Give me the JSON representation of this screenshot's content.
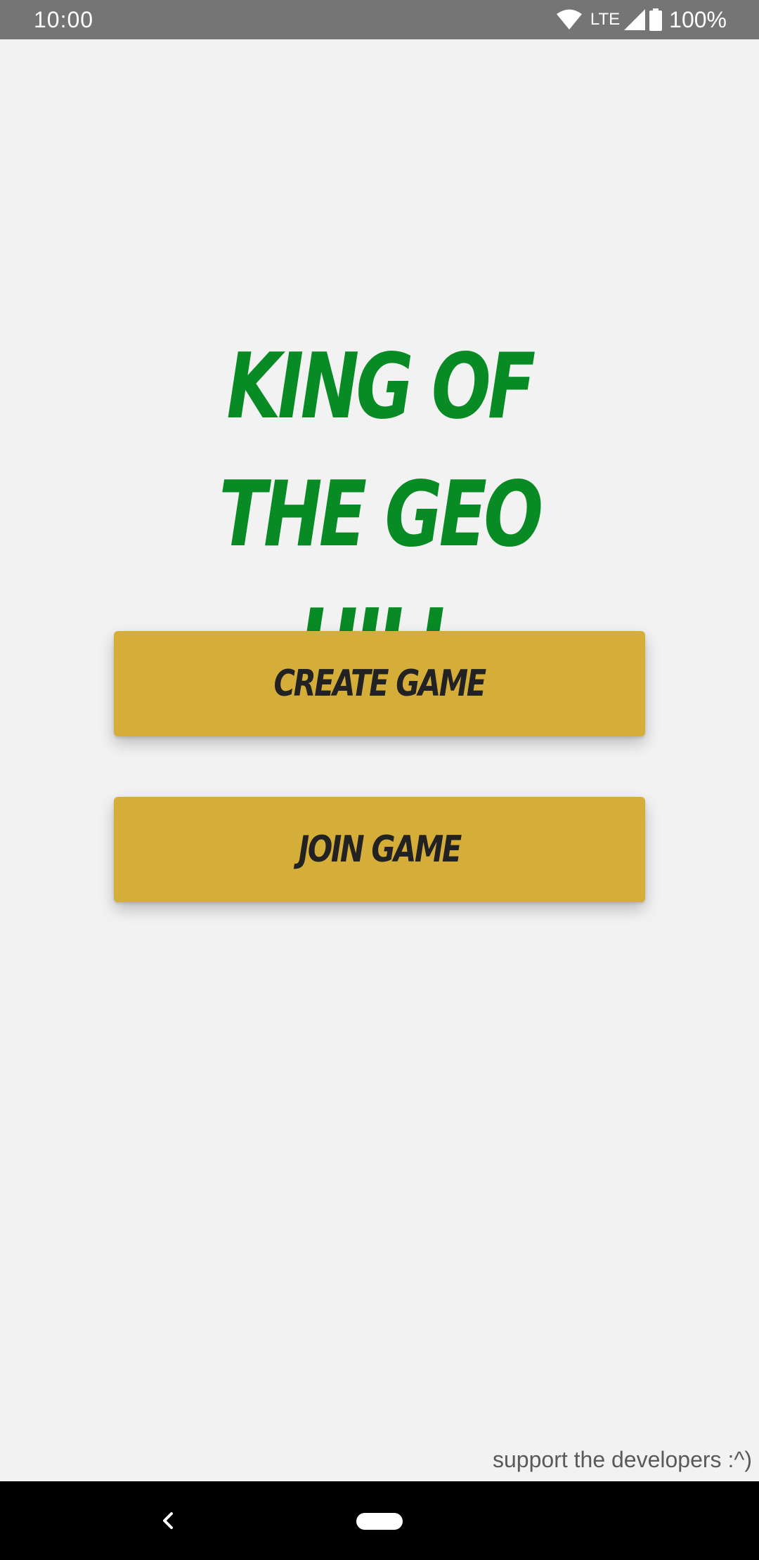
{
  "status_bar": {
    "time": "10:00",
    "network": "LTE",
    "battery": "100%",
    "icons": [
      "wifi-icon",
      "cell-signal-icon",
      "battery-icon"
    ]
  },
  "main": {
    "title": "King of the Geo Hill",
    "buttons": [
      {
        "label": "Create Game"
      },
      {
        "label": "Join Game"
      }
    ],
    "support_link": "support the developers :^)"
  },
  "nav_bar": {
    "icons": [
      "back-icon",
      "home-pill-icon"
    ]
  },
  "colors": {
    "background": "#f2f2f2",
    "title": "#088a25",
    "button": "#d4ae38",
    "button_text": "#222222",
    "status_bar": "#757575",
    "nav_bar": "#000000"
  }
}
